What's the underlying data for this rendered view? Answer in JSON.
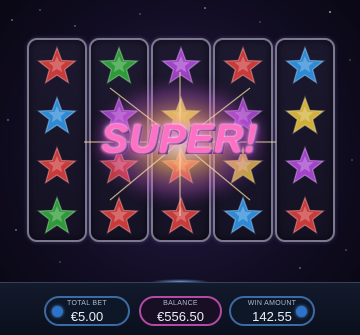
{
  "reels": [
    [
      "#c93a3a",
      "#2f8ad6",
      "#c93a3a",
      "#2f9a3a"
    ],
    [
      "#2f9a3a",
      "#a244c9",
      "#c93a3a",
      "#c93a3a"
    ],
    [
      "#a244c9",
      "#c9c93a",
      "#c93a3a",
      "#c93a3a"
    ],
    [
      "#c93a3a",
      "#a244c9",
      "#d0b03a",
      "#2f8ad6"
    ],
    [
      "#2f8ad6",
      "#d0b03a",
      "#a244c9",
      "#c93a3a"
    ]
  ],
  "banner": "SUPER!",
  "footer": {
    "total_bet": {
      "label": "TOTAL BET",
      "value": "€5.00"
    },
    "balance": {
      "label": "BALANCE",
      "value": "€556.50"
    },
    "win_amount": {
      "label": "WIN AMOUNT",
      "value": "142.55"
    }
  }
}
